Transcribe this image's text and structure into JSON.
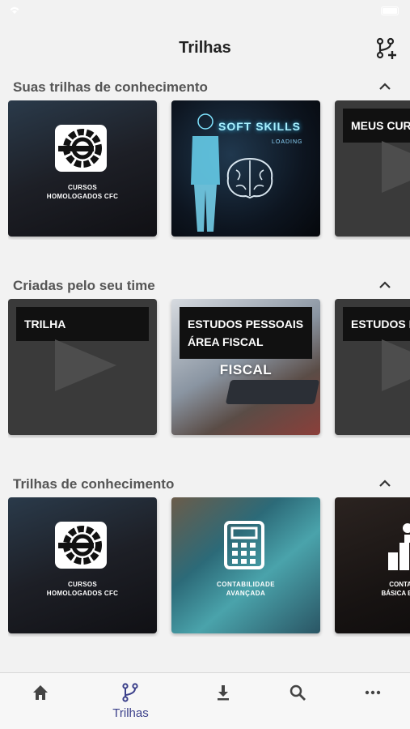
{
  "header": {
    "title": "Trilhas",
    "action_icon": "branch-add-icon"
  },
  "sections": [
    {
      "title": "Suas trilhas de conhecimento",
      "cards": [
        {
          "type": "cfc",
          "caption_line1": "CURSOS",
          "caption_line2": "HOMOLOGADOS CFC"
        },
        {
          "type": "softskills",
          "title": "SOFT SKILLS",
          "subtitle": "LOADING"
        },
        {
          "type": "placeholder",
          "label": "MEUS CURSOS"
        }
      ]
    },
    {
      "title": "Criadas pelo seu time",
      "cards": [
        {
          "type": "placeholder",
          "label": "TRILHA"
        },
        {
          "type": "fiscal",
          "label_line1": "ESTUDOS PESSOAIS",
          "label_line2": "ÁREA FISCAL",
          "image_text": "FISCAL"
        },
        {
          "type": "placeholder",
          "label": "ESTUDOS D"
        }
      ]
    },
    {
      "title": "Trilhas de conhecimento",
      "cards": [
        {
          "type": "cfc",
          "caption_line1": "CURSOS",
          "caption_line2": "HOMOLOGADOS CFC"
        },
        {
          "type": "contabilidade",
          "caption_line1": "CONTABILIDADE",
          "caption_line2": "AVANÇADA"
        },
        {
          "type": "basica",
          "caption_line1": "CONTAB",
          "caption_line2": "BÁSICA E INT"
        }
      ]
    }
  ],
  "tabs": [
    {
      "name": "home",
      "icon": "home-icon",
      "label": ""
    },
    {
      "name": "trilhas",
      "icon": "branch-icon",
      "label": "Trilhas",
      "active": true
    },
    {
      "name": "downloads",
      "icon": "download-icon",
      "label": ""
    },
    {
      "name": "search",
      "icon": "search-icon",
      "label": ""
    },
    {
      "name": "more",
      "icon": "more-icon",
      "label": ""
    }
  ],
  "colors": {
    "active_tab": "#3a3f8a",
    "icon_gray": "#444444",
    "background": "#f2f2f2"
  }
}
